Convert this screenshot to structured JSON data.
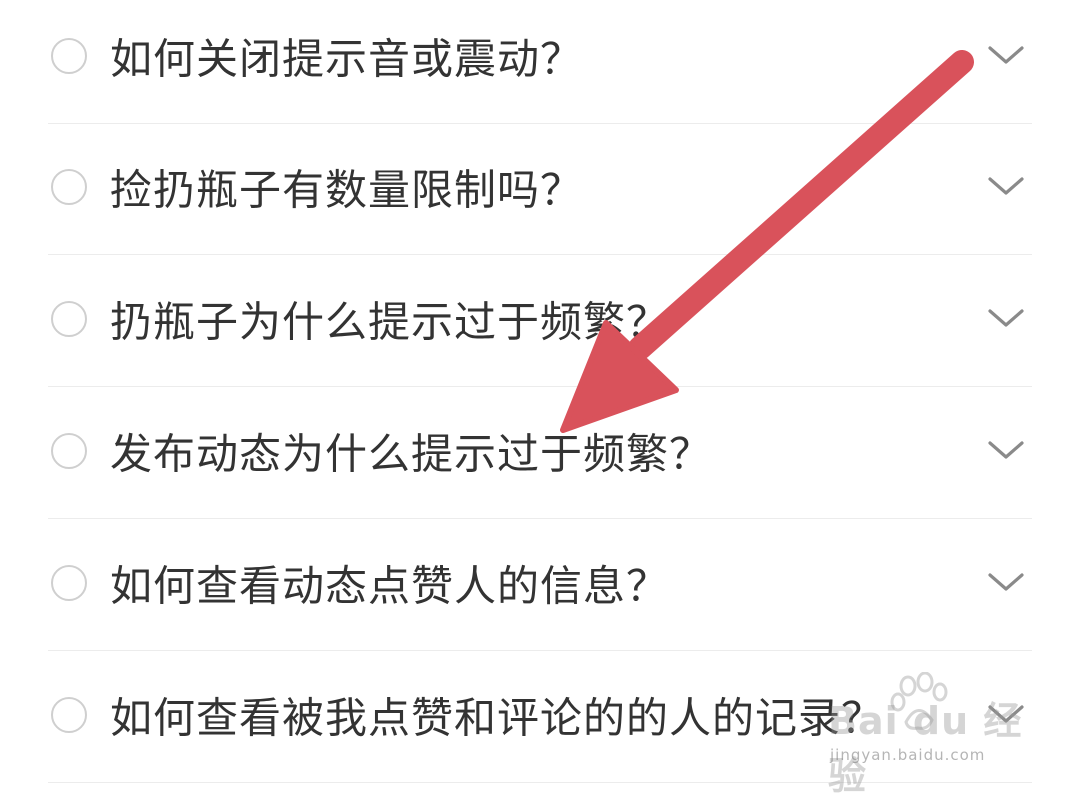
{
  "faq": {
    "items": [
      {
        "question": "如何关闭提示音或震动？"
      },
      {
        "question": "捡扔瓶子有数量限制吗？"
      },
      {
        "question": "扔瓶子为什么提示过于频繁？"
      },
      {
        "question": "发布动态为什么提示过于频繁？"
      },
      {
        "question": "如何查看动态点赞人的信息？"
      },
      {
        "question": "如何查看被我点赞和评论的的人的记录？"
      }
    ]
  },
  "annotation": {
    "arrow_color": "#d9525b",
    "pointing_to_item": 4
  },
  "watermark": {
    "brand": "Bai du 经验",
    "url": "jingyan.baidu.com"
  },
  "colors": {
    "question_text": "#333333",
    "radio_border": "#cfcfcf",
    "chevron": "#8a8a8a",
    "divider": "#ececec"
  },
  "icons": {
    "radio": "radio-circle-icon",
    "chevron": "chevron-down-icon",
    "arrow": "arrow-annotation-icon"
  }
}
